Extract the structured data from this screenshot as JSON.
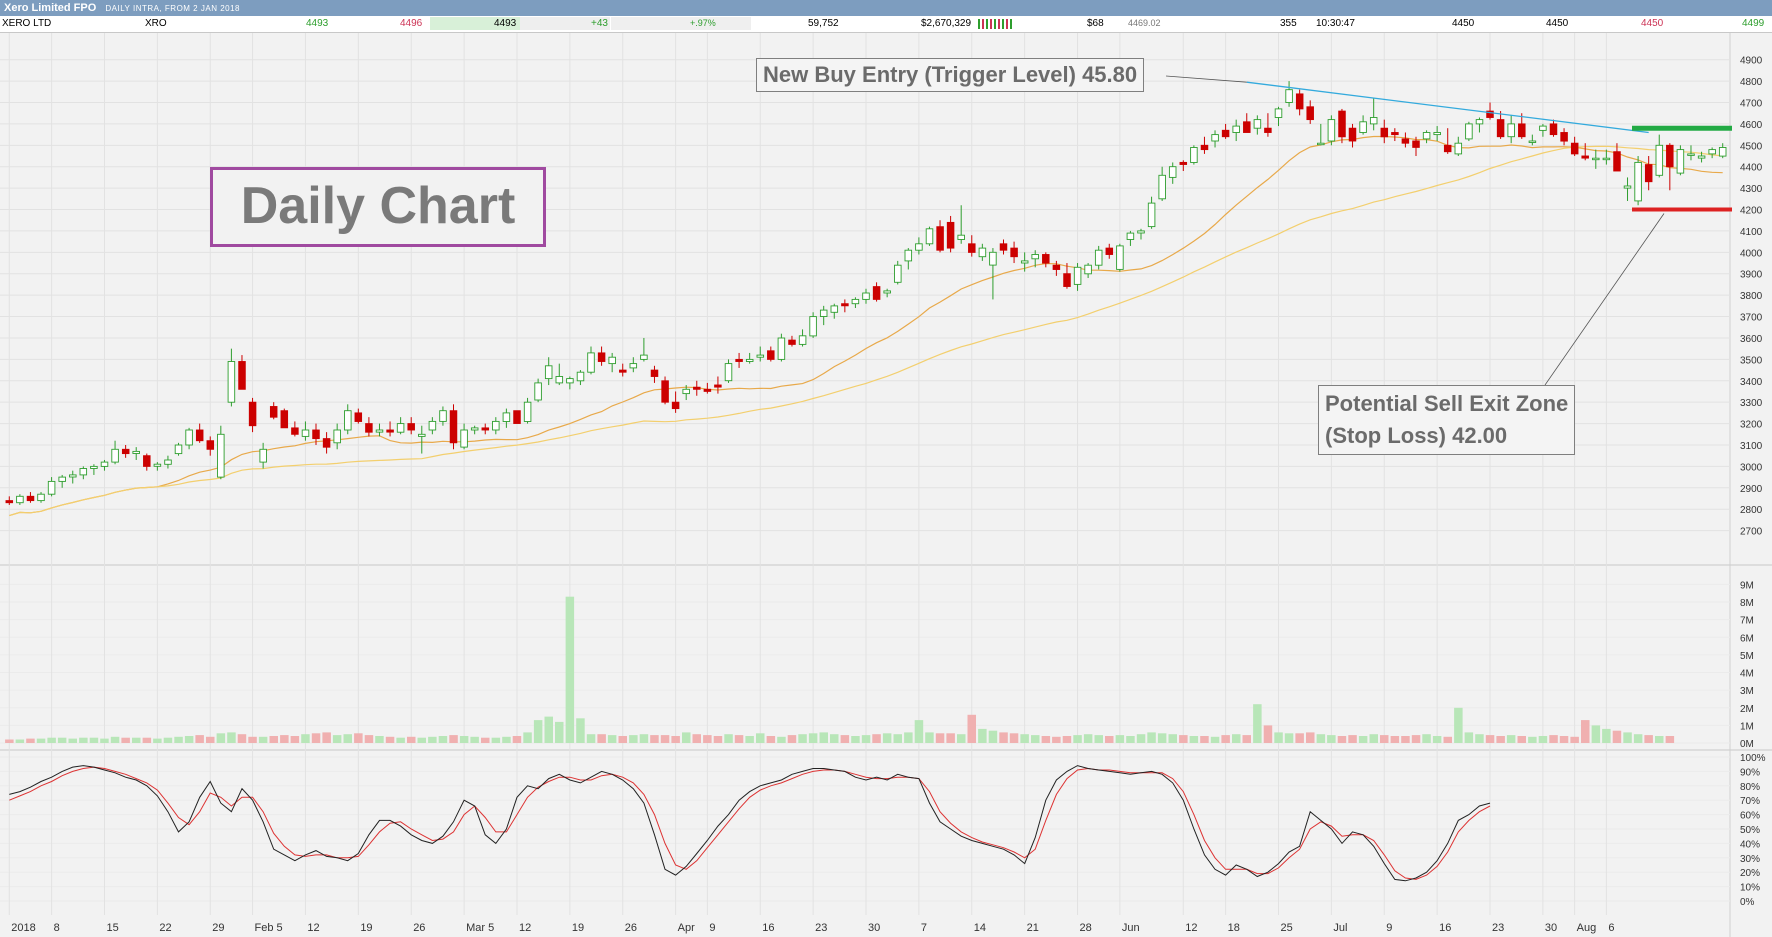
{
  "window": {
    "title": "Xero Limited FPO",
    "subtitle": "DAILY INTRA, FROM 2 JAN 2018"
  },
  "quote": {
    "name": "XERO LTD",
    "code": "XRO",
    "bid": "4493",
    "ask": "4496",
    "last": "4493",
    "change": "+43",
    "change_pct": "+.97%",
    "volume": "59,752",
    "value": "$2,670,329",
    "trades": "$68",
    "vwap": "4469.02",
    "count": "355",
    "time": "10:30:47",
    "open": "4450",
    "high": "4450",
    "low": "4450",
    "price": "4499"
  },
  "annotations": {
    "buy_entry": "New Buy Entry (Trigger Level) 45.80",
    "sell_exit_line1": "Potential Sell Exit Zone",
    "sell_exit_line2": "(Stop Loss) 42.00",
    "daily_chart": "Daily Chart"
  },
  "colors": {
    "up": "#2e9e2e",
    "up_fill": "#ffffff",
    "down": "#cc0000",
    "ma_fast": "#e8a94a",
    "ma_slow": "#f3cf6e",
    "trendline": "#33aadd",
    "buy_level": "#22aa44",
    "stop_level": "#dd2222",
    "vol_up": "#b8e6b8",
    "vol_down": "#f0b0b0",
    "stoch_k": "#222222",
    "stoch_d": "#dd3333",
    "titlebar": "#7d9dbf"
  },
  "chart_data": {
    "type": "candlestick",
    "price_ticks": [
      2700,
      2800,
      2900,
      3000,
      3100,
      3200,
      3300,
      3400,
      3500,
      3600,
      3700,
      3800,
      3900,
      4000,
      4100,
      4200,
      4300,
      4400,
      4500,
      4600,
      4700,
      4800,
      4900
    ],
    "price_range": [
      2600,
      4950
    ],
    "volume_ticks": [
      "0M",
      "1M",
      "2M",
      "3M",
      "4M",
      "5M",
      "6M",
      "7M",
      "8M",
      "9M"
    ],
    "volume_range": [
      0,
      9
    ],
    "stoch_ticks": [
      "0%",
      "10%",
      "20%",
      "30%",
      "40%",
      "50%",
      "60%",
      "70%",
      "80%",
      "90%",
      "100%"
    ],
    "x_ticks": [
      "2018",
      "8",
      "15",
      "22",
      "29",
      "Feb 5",
      "12",
      "19",
      "26",
      "Mar 5",
      "12",
      "19",
      "26",
      "Apr",
      "9",
      "16",
      "23",
      "30",
      "7",
      "14",
      "21",
      "28",
      "Jun",
      "12",
      "18",
      "25",
      "Jul",
      "9",
      "16",
      "23",
      "30",
      "Aug",
      "6"
    ],
    "x_tick_index": [
      0,
      4,
      9,
      14,
      19,
      23,
      28,
      33,
      38,
      43,
      48,
      53,
      58,
      63,
      66,
      71,
      76,
      81,
      86,
      91,
      96,
      101,
      105,
      111,
      115,
      120,
      125,
      130,
      135,
      140,
      145,
      148,
      151
    ],
    "trend_line": {
      "from": [
        117,
        4795
      ],
      "to": [
        155,
        4560
      ]
    },
    "buy_level": 4580,
    "stop_level": 4200,
    "ohlc": [
      [
        2840,
        2860,
        2820,
        2830
      ],
      [
        2830,
        2870,
        2820,
        2860
      ],
      [
        2860,
        2880,
        2830,
        2840
      ],
      [
        2840,
        2880,
        2830,
        2870
      ],
      [
        2870,
        2950,
        2860,
        2930
      ],
      [
        2930,
        2960,
        2900,
        2950
      ],
      [
        2950,
        2980,
        2920,
        2960
      ],
      [
        2960,
        3000,
        2940,
        2990
      ],
      [
        2990,
        3010,
        2960,
        3000
      ],
      [
        3000,
        3030,
        2980,
        3020
      ],
      [
        3020,
        3120,
        3010,
        3080
      ],
      [
        3080,
        3100,
        3040,
        3060
      ],
      [
        3060,
        3090,
        3030,
        3070
      ],
      [
        3050,
        3060,
        2980,
        3000
      ],
      [
        3000,
        3020,
        2980,
        3010
      ],
      [
        3010,
        3050,
        2990,
        3030
      ],
      [
        3060,
        3110,
        3050,
        3100
      ],
      [
        3100,
        3180,
        3080,
        3170
      ],
      [
        3170,
        3200,
        3110,
        3120
      ],
      [
        3120,
        3140,
        3050,
        3080
      ],
      [
        2950,
        3190,
        2940,
        3150
      ],
      [
        3300,
        3550,
        3280,
        3490
      ],
      [
        3490,
        3520,
        3370,
        3360
      ],
      [
        3300,
        3320,
        3160,
        3190
      ],
      [
        3020,
        3110,
        2990,
        3080
      ],
      [
        3280,
        3300,
        3220,
        3230
      ],
      [
        3260,
        3270,
        3180,
        3180
      ],
      [
        3180,
        3210,
        3140,
        3150
      ],
      [
        3140,
        3210,
        3120,
        3170
      ],
      [
        3170,
        3200,
        3100,
        3130
      ],
      [
        3130,
        3160,
        3060,
        3090
      ],
      [
        3110,
        3200,
        3080,
        3170
      ],
      [
        3170,
        3290,
        3150,
        3260
      ],
      [
        3250,
        3270,
        3200,
        3210
      ],
      [
        3200,
        3230,
        3140,
        3160
      ],
      [
        3160,
        3200,
        3140,
        3170
      ],
      [
        3170,
        3210,
        3140,
        3160
      ],
      [
        3160,
        3230,
        3150,
        3200
      ],
      [
        3200,
        3230,
        3150,
        3170
      ],
      [
        3140,
        3190,
        3060,
        3150
      ],
      [
        3170,
        3230,
        3150,
        3210
      ],
      [
        3210,
        3280,
        3190,
        3260
      ],
      [
        3260,
        3290,
        3080,
        3110
      ],
      [
        3090,
        3200,
        3080,
        3170
      ],
      [
        3170,
        3190,
        3150,
        3180
      ],
      [
        3180,
        3200,
        3150,
        3170
      ],
      [
        3170,
        3230,
        3150,
        3210
      ],
      [
        3210,
        3270,
        3180,
        3250
      ],
      [
        3260,
        3230,
        3200,
        3200
      ],
      [
        3210,
        3320,
        3200,
        3300
      ],
      [
        3310,
        3410,
        3300,
        3390
      ],
      [
        3410,
        3510,
        3380,
        3470
      ],
      [
        3390,
        3480,
        3380,
        3420
      ],
      [
        3390,
        3420,
        3360,
        3410
      ],
      [
        3400,
        3450,
        3380,
        3440
      ],
      [
        3440,
        3560,
        3430,
        3530
      ],
      [
        3530,
        3560,
        3470,
        3490
      ],
      [
        3480,
        3530,
        3440,
        3510
      ],
      [
        3450,
        3480,
        3420,
        3440
      ],
      [
        3460,
        3510,
        3440,
        3480
      ],
      [
        3500,
        3600,
        3490,
        3520
      ],
      [
        3450,
        3470,
        3390,
        3420
      ],
      [
        3400,
        3420,
        3290,
        3300
      ],
      [
        3300,
        3350,
        3250,
        3270
      ],
      [
        3340,
        3380,
        3310,
        3360
      ],
      [
        3370,
        3400,
        3330,
        3360
      ],
      [
        3360,
        3390,
        3340,
        3350
      ],
      [
        3380,
        3420,
        3340,
        3370
      ],
      [
        3400,
        3500,
        3390,
        3480
      ],
      [
        3500,
        3530,
        3460,
        3490
      ],
      [
        3490,
        3530,
        3480,
        3500
      ],
      [
        3510,
        3560,
        3490,
        3520
      ],
      [
        3540,
        3560,
        3490,
        3500
      ],
      [
        3500,
        3620,
        3490,
        3600
      ],
      [
        3590,
        3610,
        3560,
        3570
      ],
      [
        3570,
        3640,
        3560,
        3610
      ],
      [
        3610,
        3720,
        3600,
        3700
      ],
      [
        3700,
        3750,
        3660,
        3730
      ],
      [
        3720,
        3760,
        3690,
        3750
      ],
      [
        3760,
        3780,
        3720,
        3750
      ],
      [
        3760,
        3790,
        3740,
        3780
      ],
      [
        3780,
        3830,
        3760,
        3810
      ],
      [
        3840,
        3860,
        3770,
        3780
      ],
      [
        3810,
        3830,
        3790,
        3820
      ],
      [
        3860,
        3960,
        3850,
        3940
      ],
      [
        3960,
        4020,
        3920,
        4010
      ],
      [
        4010,
        4070,
        3990,
        4040
      ],
      [
        4040,
        4120,
        4030,
        4110
      ],
      [
        4120,
        4150,
        4000,
        4010
      ],
      [
        4140,
        4170,
        4000,
        4020
      ],
      [
        4060,
        4220,
        4040,
        4080
      ],
      [
        4040,
        4080,
        3980,
        4000
      ],
      [
        3980,
        4040,
        3960,
        4020
      ],
      [
        3940,
        4020,
        3780,
        4000
      ],
      [
        4040,
        4060,
        3990,
        4010
      ],
      [
        4020,
        4050,
        3950,
        3980
      ],
      [
        3950,
        4000,
        3910,
        3960
      ],
      [
        3970,
        4010,
        3930,
        3990
      ],
      [
        3990,
        4000,
        3930,
        3950
      ],
      [
        3940,
        3960,
        3890,
        3920
      ],
      [
        3900,
        3950,
        3830,
        3840
      ],
      [
        3850,
        3950,
        3820,
        3930
      ],
      [
        3900,
        3950,
        3880,
        3940
      ],
      [
        3940,
        4030,
        3920,
        4010
      ],
      [
        4020,
        4040,
        3970,
        3990
      ],
      [
        3920,
        4040,
        3910,
        4030
      ],
      [
        4060,
        4100,
        4030,
        4090
      ],
      [
        4090,
        4110,
        4060,
        4100
      ],
      [
        4120,
        4260,
        4110,
        4230
      ],
      [
        4250,
        4400,
        4240,
        4360
      ],
      [
        4350,
        4420,
        4320,
        4400
      ],
      [
        4420,
        4430,
        4380,
        4410
      ],
      [
        4420,
        4500,
        4410,
        4490
      ],
      [
        4500,
        4540,
        4460,
        4480
      ],
      [
        4520,
        4570,
        4490,
        4550
      ],
      [
        4570,
        4600,
        4530,
        4540
      ],
      [
        4560,
        4620,
        4520,
        4590
      ],
      [
        4610,
        4650,
        4560,
        4560
      ],
      [
        4580,
        4640,
        4550,
        4620
      ],
      [
        4580,
        4650,
        4540,
        4560
      ],
      [
        4630,
        4680,
        4590,
        4670
      ],
      [
        4700,
        4800,
        4680,
        4760
      ],
      [
        4740,
        4760,
        4640,
        4670
      ],
      [
        4680,
        4710,
        4600,
        4620
      ],
      [
        4510,
        4600,
        4500,
        4510
      ],
      [
        4520,
        4640,
        4500,
        4620
      ],
      [
        4660,
        4670,
        4510,
        4540
      ],
      [
        4580,
        4600,
        4490,
        4520
      ],
      [
        4560,
        4640,
        4550,
        4610
      ],
      [
        4600,
        4720,
        4570,
        4630
      ],
      [
        4580,
        4620,
        4510,
        4540
      ],
      [
        4560,
        4580,
        4520,
        4550
      ],
      [
        4530,
        4560,
        4490,
        4510
      ],
      [
        4520,
        4540,
        4450,
        4490
      ],
      [
        4530,
        4570,
        4510,
        4560
      ],
      [
        4550,
        4590,
        4520,
        4560
      ],
      [
        4500,
        4580,
        4460,
        4470
      ],
      [
        4460,
        4540,
        4450,
        4510
      ],
      [
        4530,
        4610,
        4520,
        4600
      ],
      [
        4600,
        4630,
        4560,
        4620
      ],
      [
        4660,
        4700,
        4620,
        4630
      ],
      [
        4620,
        4660,
        4530,
        4540
      ],
      [
        4540,
        4640,
        4510,
        4600
      ],
      [
        4600,
        4650,
        4530,
        4540
      ],
      [
        4520,
        4550,
        4500,
        4520
      ],
      [
        4570,
        4600,
        4540,
        4590
      ],
      [
        4600,
        4620,
        4540,
        4550
      ],
      [
        4560,
        4580,
        4500,
        4520
      ],
      [
        4510,
        4540,
        4450,
        4460
      ],
      [
        4450,
        4510,
        4430,
        4440
      ],
      [
        4440,
        4480,
        4390,
        4440
      ],
      [
        4440,
        4480,
        4410,
        4440
      ],
      [
        4470,
        4510,
        4380,
        4380
      ],
      [
        4300,
        4350,
        4240,
        4310
      ],
      [
        4240,
        4450,
        4220,
        4420
      ],
      [
        4410,
        4450,
        4290,
        4330
      ],
      [
        4360,
        4550,
        4350,
        4500
      ],
      [
        4500,
        4510,
        4290,
        4400
      ],
      [
        4370,
        4500,
        4360,
        4480
      ],
      [
        4460,
        4500,
        4430,
        4460
      ],
      [
        4440,
        4470,
        4420,
        4450
      ],
      [
        4460,
        4490,
        4440,
        4480
      ],
      [
        4450,
        4510,
        4440,
        4490
      ]
    ],
    "volume": [
      0.2,
      0.2,
      0.25,
      0.25,
      0.3,
      0.3,
      0.25,
      0.3,
      0.3,
      0.25,
      0.35,
      0.3,
      0.3,
      0.3,
      0.25,
      0.3,
      0.35,
      0.4,
      0.45,
      0.35,
      0.55,
      0.6,
      0.5,
      0.35,
      0.35,
      0.4,
      0.45,
      0.4,
      0.5,
      0.55,
      0.6,
      0.45,
      0.5,
      0.55,
      0.45,
      0.4,
      0.35,
      0.3,
      0.35,
      0.3,
      0.35,
      0.4,
      0.45,
      0.4,
      0.35,
      0.3,
      0.3,
      0.35,
      0.4,
      0.6,
      1.3,
      1.5,
      1.2,
      8.3,
      1.4,
      0.5,
      0.5,
      0.45,
      0.4,
      0.45,
      0.5,
      0.45,
      0.45,
      0.4,
      0.6,
      0.5,
      0.45,
      0.4,
      0.5,
      0.45,
      0.4,
      0.55,
      0.4,
      0.35,
      0.45,
      0.5,
      0.55,
      0.6,
      0.5,
      0.45,
      0.4,
      0.45,
      0.5,
      0.55,
      0.5,
      0.6,
      1.3,
      0.6,
      0.55,
      0.55,
      0.5,
      1.6,
      0.8,
      0.7,
      0.6,
      0.55,
      0.5,
      0.45,
      0.4,
      0.35,
      0.4,
      0.45,
      0.5,
      0.45,
      0.4,
      0.45,
      0.4,
      0.5,
      0.6,
      0.55,
      0.5,
      0.45,
      0.4,
      0.4,
      0.35,
      0.45,
      0.5,
      0.45,
      2.2,
      1.0,
      0.6,
      0.55,
      0.55,
      0.6,
      0.5,
      0.45,
      0.4,
      0.45,
      0.4,
      0.5,
      0.45,
      0.4,
      0.4,
      0.45,
      0.5,
      0.4,
      0.35,
      2.0,
      0.6,
      0.5,
      0.45,
      0.4,
      0.45,
      0.4,
      0.35,
      0.4,
      0.45,
      0.4,
      0.35,
      1.3,
      1.0,
      0.8,
      0.7,
      0.6,
      0.5,
      0.45,
      0.4,
      0.4
    ],
    "stoch_k": [
      74,
      76,
      79,
      83,
      86,
      90,
      93,
      94,
      93,
      91,
      89,
      86,
      84,
      80,
      73,
      62,
      48,
      55,
      72,
      83,
      68,
      62,
      78,
      70,
      55,
      36,
      32,
      28,
      32,
      35,
      31,
      30,
      28,
      33,
      46,
      56,
      56,
      52,
      46,
      42,
      40,
      45,
      55,
      70,
      66,
      46,
      40,
      50,
      72,
      80,
      78,
      85,
      88,
      84,
      82,
      86,
      90,
      88,
      84,
      78,
      68,
      46,
      22,
      18,
      24,
      33,
      42,
      52,
      60,
      70,
      76,
      80,
      82,
      84,
      88,
      90,
      92,
      92,
      91,
      90,
      86,
      84,
      86,
      84,
      88,
      86,
      85,
      68,
      55,
      50,
      45,
      42,
      40,
      38,
      36,
      32,
      26,
      44,
      70,
      84,
      90,
      94,
      92,
      91,
      90,
      89,
      88,
      89,
      90,
      88,
      82,
      70,
      50,
      32,
      22,
      18,
      25,
      22,
      17,
      20,
      26,
      34,
      38,
      62,
      56,
      50,
      40,
      48,
      46,
      38,
      26,
      15,
      14,
      16,
      20,
      28,
      40,
      56,
      60,
      66,
      68
    ],
    "stoch_d": [
      70,
      73,
      76,
      80,
      83,
      87,
      90,
      92,
      93,
      92,
      90,
      88,
      85,
      82,
      77,
      68,
      58,
      53,
      62,
      75,
      72,
      66,
      72,
      72,
      62,
      47,
      38,
      32,
      31,
      32,
      32,
      30,
      30,
      31,
      39,
      48,
      54,
      55,
      50,
      46,
      42,
      43,
      48,
      60,
      66,
      58,
      48,
      48,
      60,
      72,
      79,
      83,
      86,
      86,
      84,
      84,
      87,
      88,
      86,
      82,
      74,
      60,
      40,
      25,
      22,
      28,
      37,
      46,
      55,
      64,
      72,
      77,
      80,
      82,
      85,
      88,
      90,
      91,
      91,
      90,
      88,
      86,
      85,
      85,
      86,
      86,
      85,
      76,
      62,
      54,
      48,
      44,
      41,
      39,
      37,
      34,
      30,
      36,
      56,
      74,
      85,
      91,
      92,
      91,
      91,
      90,
      89,
      89,
      89,
      89,
      85,
      76,
      60,
      42,
      30,
      22,
      22,
      22,
      19,
      19,
      23,
      30,
      36,
      50,
      55,
      52,
      45,
      46,
      46,
      42,
      32,
      21,
      16,
      15,
      18,
      24,
      34,
      48,
      56,
      62,
      66
    ]
  }
}
